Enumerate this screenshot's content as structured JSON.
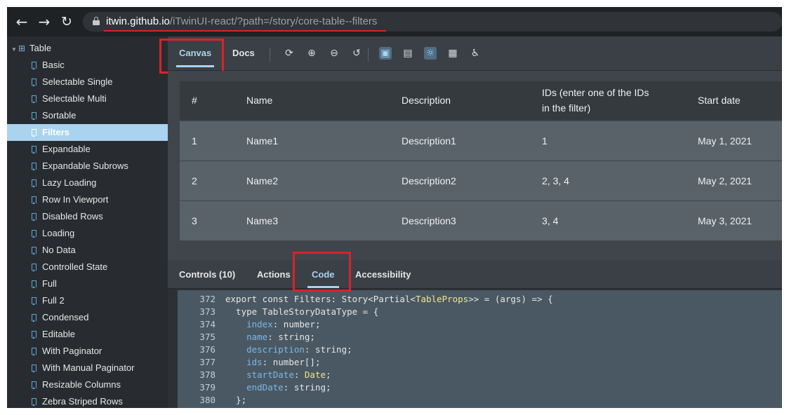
{
  "browser": {
    "url_host": "itwin.github.io",
    "url_path": "/iTwinUI-react/?path=/story/core-table--filters",
    "back_icon": "←",
    "forward_icon": "→",
    "reload_icon": "↻"
  },
  "sidebar": {
    "root_label": "Table",
    "items": [
      {
        "label": "Basic"
      },
      {
        "label": "Selectable Single"
      },
      {
        "label": "Selectable Multi"
      },
      {
        "label": "Sortable"
      },
      {
        "label": "Filters",
        "active": true
      },
      {
        "label": "Expandable"
      },
      {
        "label": "Expandable Subrows"
      },
      {
        "label": "Lazy Loading"
      },
      {
        "label": "Row In Viewport"
      },
      {
        "label": "Disabled Rows"
      },
      {
        "label": "Loading"
      },
      {
        "label": "No Data"
      },
      {
        "label": "Controlled State"
      },
      {
        "label": "Full"
      },
      {
        "label": "Full 2"
      },
      {
        "label": "Condensed"
      },
      {
        "label": "Editable"
      },
      {
        "label": "With Paginator"
      },
      {
        "label": "With Manual Paginator"
      },
      {
        "label": "Resizable Columns"
      },
      {
        "label": "Zebra Striped Rows"
      }
    ]
  },
  "toolbar": {
    "tabs": [
      {
        "label": "Canvas",
        "active": true
      },
      {
        "label": "Docs"
      }
    ],
    "icons": [
      "reload-icon",
      "zoom-in-icon",
      "zoom-out-icon",
      "reset-zoom-icon",
      "background-icon",
      "viewport-icon",
      "theme-icon",
      "grid-icon",
      "accessibility-icon"
    ]
  },
  "table": {
    "headers": [
      "#",
      "Name",
      "Description",
      "IDs (enter one of the IDs in the filter)",
      "Start date"
    ],
    "rows": [
      [
        "1",
        "Name1",
        "Description1",
        "1",
        "May 1, 2021"
      ],
      [
        "2",
        "Name2",
        "Description2",
        "2, 3, 4",
        "May 2, 2021"
      ],
      [
        "3",
        "Name3",
        "Description3",
        "3, 4",
        "May 3, 2021"
      ]
    ]
  },
  "addons": {
    "tabs": [
      {
        "label": "Controls (10)"
      },
      {
        "label": "Actions"
      },
      {
        "label": "Code",
        "active": true
      },
      {
        "label": "Accessibility"
      }
    ]
  },
  "code": {
    "lines": [
      {
        "num": "372",
        "segs": [
          [
            "kw",
            "export const Filters: Story<Partial<"
          ],
          [
            "ty",
            "TableProps"
          ],
          [
            "kw",
            ">> = (args) => {"
          ]
        ]
      },
      {
        "num": "373",
        "segs": [
          [
            "kw",
            "  type TableStoryDataType = {"
          ]
        ]
      },
      {
        "num": "374",
        "segs": [
          [
            "kw",
            "    "
          ],
          [
            "prop",
            "index"
          ],
          [
            "kw",
            ": number;"
          ]
        ]
      },
      {
        "num": "375",
        "segs": [
          [
            "kw",
            "    "
          ],
          [
            "prop",
            "name"
          ],
          [
            "kw",
            ": string;"
          ]
        ]
      },
      {
        "num": "376",
        "segs": [
          [
            "kw",
            "    "
          ],
          [
            "prop",
            "description"
          ],
          [
            "kw",
            ": string;"
          ]
        ]
      },
      {
        "num": "377",
        "segs": [
          [
            "kw",
            "    "
          ],
          [
            "prop",
            "ids"
          ],
          [
            "kw",
            ": number[];"
          ]
        ]
      },
      {
        "num": "378",
        "segs": [
          [
            "kw",
            "    "
          ],
          [
            "prop",
            "startDate"
          ],
          [
            "kw",
            ": "
          ],
          [
            "ty",
            "Date"
          ],
          [
            "kw",
            ";"
          ]
        ]
      },
      {
        "num": "379",
        "segs": [
          [
            "kw",
            "    "
          ],
          [
            "prop",
            "endDate"
          ],
          [
            "kw",
            ": string;"
          ]
        ]
      },
      {
        "num": "380",
        "segs": [
          [
            "kw",
            "  };"
          ]
        ]
      }
    ]
  },
  "colors": {
    "accent": "#a9d3ee",
    "highlight_red": "#d8232a"
  }
}
